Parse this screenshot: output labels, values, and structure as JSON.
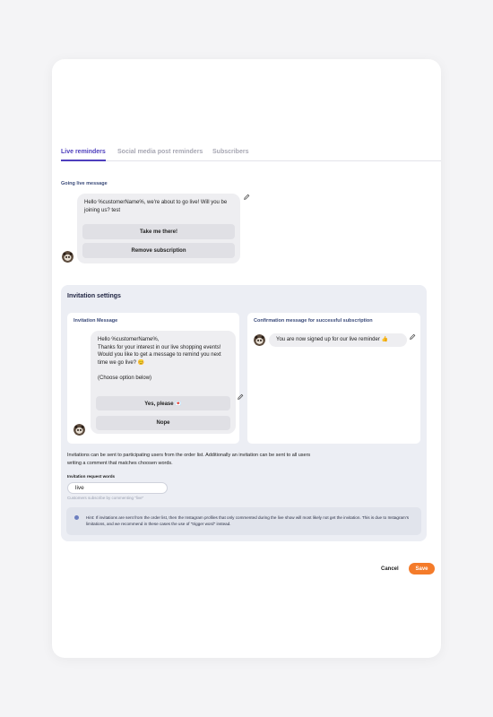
{
  "tabs": [
    {
      "label": "Live reminders"
    },
    {
      "label": "Social media post reminders"
    },
    {
      "label": "Subscribers"
    }
  ],
  "going_live": {
    "section_label": "Going live message",
    "message": "Hello %customerName%, we're about to go live! Will you be joining us? test",
    "buttons": [
      "Take me there!",
      "Remove subscription"
    ]
  },
  "invitation": {
    "title": "Invitation settings",
    "invitation_message": {
      "label": "Invitation Message",
      "text": "Hello %customerName%,\nThanks for your interest in our live shopping events! Would you like to get a message to remind you next time we go live? 😊\n\n(Choose option below)",
      "buttons": [
        "Yes, please 💌",
        "Nope"
      ]
    },
    "confirmation": {
      "label": "Confirmation message for successful subscription",
      "text": "You are now signed up for our live reminder 👍"
    },
    "info_text": "Invitations can be sent to participating users from the order list. Additionally an invitation can be sent to all users writing a comment that matches choosen words.",
    "request_words": {
      "label": "Invitation request words",
      "value": "live",
      "helper": "Customers subscribe by commenting \"live\""
    },
    "hint": "Hint: If invitations are sent from the order list, then the Instagram profiles that only commented during the live show will most likely not get the invitation. This is due to Instagram's limitations, and we recommend in these cases the use of \"trigger word\" instead."
  },
  "footer": {
    "cancel_label": "Cancel",
    "save_label": "Save"
  },
  "colors": {
    "accent": "#4e3fbd",
    "save_button": "#f47b2a",
    "panel_bg": "#eceef4",
    "bubble_bg": "#eeeef1"
  }
}
